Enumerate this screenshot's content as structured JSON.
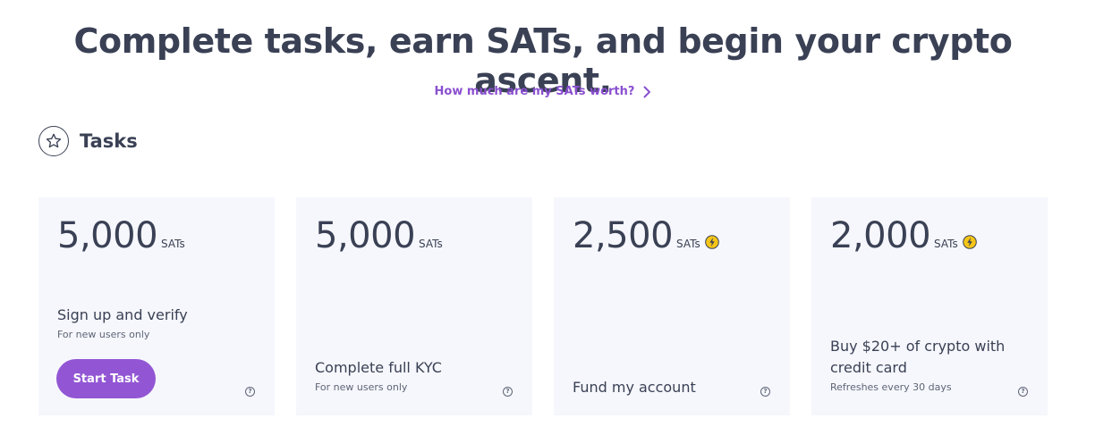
{
  "header": {
    "headline": "Complete tasks, earn SATs, and begin your crypto ascent.",
    "worth_link": "How much are my SATs worth?"
  },
  "tasks_section": {
    "title": "Tasks",
    "help_glyph": "?",
    "cards": [
      {
        "amount": "5,000",
        "unit": "SATs",
        "boosted": false,
        "title": "Sign up and verify",
        "subtitle": "For new users only",
        "button_label": "Start Task"
      },
      {
        "amount": "5,000",
        "unit": "SATs",
        "boosted": false,
        "title": "Complete full KYC",
        "subtitle": "For new users only"
      },
      {
        "amount": "2,500",
        "unit": "SATs",
        "boosted": true,
        "title": "Fund my account",
        "subtitle": ""
      },
      {
        "amount": "2,000",
        "unit": "SATs",
        "boosted": true,
        "title": "Buy $20+ of crypto with credit card",
        "subtitle": "Refreshes every 30 days"
      }
    ]
  },
  "colors": {
    "text": "#3a4155",
    "accent": "#8a4fd0",
    "button": "#9256d4",
    "card_bg": "#f6f7fc",
    "bolt": "#f5c518"
  },
  "icons": {
    "star": "star-icon",
    "chevron": "chevron-right-icon",
    "bolt": "lightning-bolt-icon",
    "help": "help-icon"
  }
}
